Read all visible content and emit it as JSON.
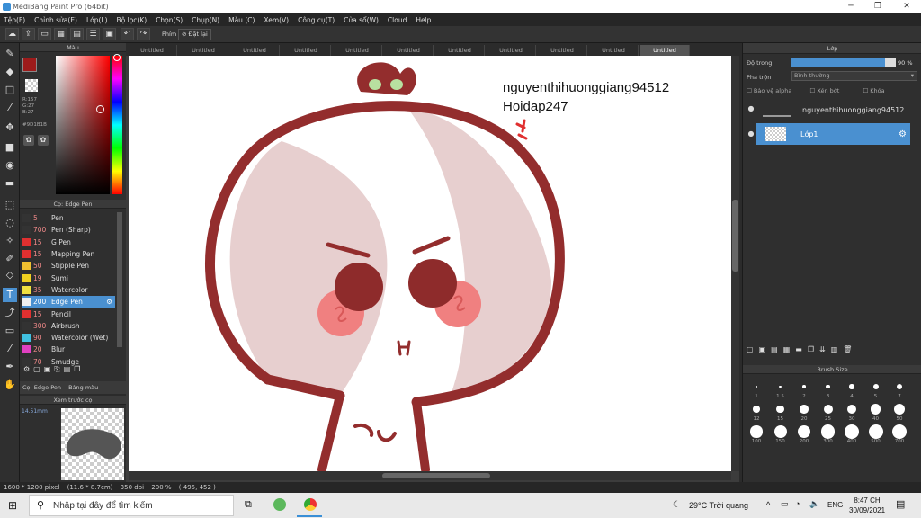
{
  "window": {
    "title": "MediBang Paint Pro (64bit)"
  },
  "menu": [
    "Tệp(F)",
    "Chỉnh sửa(E)",
    "Lớp(L)",
    "Bộ lọc(K)",
    "Chọn(S)",
    "Chụp(N)",
    "Màu (C)",
    "Xem(V)",
    "Công cụ(T)",
    "Cửa sổ(W)",
    "Cloud",
    "Help"
  ],
  "toolbar": {
    "mode_label": "Phím",
    "reset_label": "Đặt lại"
  },
  "color_panel": {
    "title": "Màu",
    "rgb": [
      "R:157",
      "G:27",
      "B:27"
    ],
    "hex": "#9D1B1B",
    "fg": "#9d1b1b"
  },
  "brush_panel": {
    "title": "Cọ: Edge Pen",
    "tab_brush": "Cọ: Edge Pen",
    "tab_palette": "Bảng màu",
    "brushes": [
      {
        "size": "5",
        "name": "Pen",
        "color": "#333333"
      },
      {
        "size": "700",
        "name": "Pen (Sharp)",
        "color": "#333333"
      },
      {
        "size": "15",
        "name": "G Pen",
        "color": "#e03030"
      },
      {
        "size": "15",
        "name": "Mapping Pen",
        "color": "#e03030"
      },
      {
        "size": "50",
        "name": "Stipple Pen",
        "color": "#f0c030"
      },
      {
        "size": "19",
        "name": "Sumi",
        "color": "#f0d020"
      },
      {
        "size": "35",
        "name": "Watercolor",
        "color": "#f0e040"
      },
      {
        "size": "200",
        "name": "Edge Pen",
        "color": "#f0f0f0"
      },
      {
        "size": "15",
        "name": "Pencil",
        "color": "#e03030"
      },
      {
        "size": "300",
        "name": "Airbrush",
        "color": "#333333"
      },
      {
        "size": "90",
        "name": "Watercolor (Wet)",
        "color": "#40c0e0"
      },
      {
        "size": "20",
        "name": "Blur",
        "color": "#e040c0"
      },
      {
        "size": "70",
        "name": "Smudge",
        "color": "#333333"
      }
    ],
    "selected": 7
  },
  "navigator": {
    "title": "Xem trước cọ",
    "size": "14.51mm"
  },
  "tabs": [
    "Untitled",
    "Untitled",
    "Untitled",
    "Untitled",
    "Untitled",
    "Untitled",
    "Untitled",
    "Untitled",
    "Untitled",
    "Untitled",
    "Untitled"
  ],
  "canvas_text": {
    "line1": "nguyenthihuonggiang94512",
    "line2": "Hoidap247"
  },
  "layer_panel": {
    "title": "Lớp",
    "opacity_label": "Độ trong",
    "opacity_value": "90 %",
    "opacity": 0.9,
    "blend_label": "Pha trộn",
    "blend_value": "Bình thường",
    "protect_alpha": "Bảo vệ alpha",
    "clipping": "Xén bớt",
    "lock": "Khóa",
    "layers": [
      {
        "name": "nguyenthihuonggiang94512"
      },
      {
        "name": "Lớp1"
      }
    ]
  },
  "brush_size": {
    "title": "Brush Size",
    "sizes": [
      "1",
      "1.5",
      "2",
      "3",
      "4",
      "5",
      "7",
      "12",
      "15",
      "20",
      "25",
      "30",
      "40",
      "50",
      "100",
      "150",
      "200",
      "300",
      "400",
      "500",
      "700"
    ]
  },
  "status": {
    "dims": "1600 * 1200 pixel",
    "phys": "(11.6 * 8.7cm)",
    "dpi": "350 dpi",
    "zoom": "200 %",
    "coords": "( 495, 452 )"
  },
  "taskbar": {
    "search_placeholder": "Nhập tại đây để tìm kiếm",
    "weather": "29°C  Trời quang",
    "lang": "ENG",
    "time": "8:47 CH",
    "date": "30/09/2021"
  }
}
